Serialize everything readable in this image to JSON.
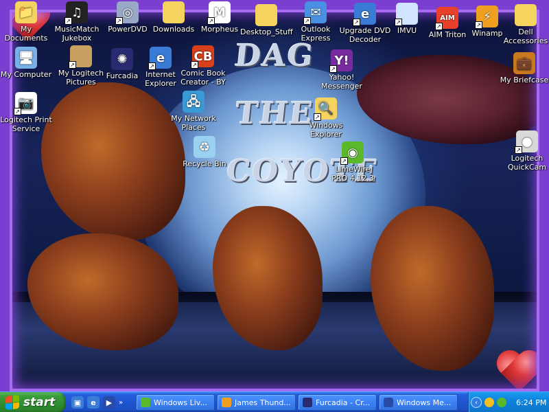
{
  "wallpaper": {
    "title_line1": "DAG",
    "title_line2": "THE",
    "title_line3": "COYOTE"
  },
  "desktop_icons": [
    {
      "id": "my-documents",
      "label": "My Documents",
      "icon": "folder-documents-icon",
      "color": "#f4d35e",
      "symbol": "📁"
    },
    {
      "id": "musicmatch",
      "label": "MusicMatch Jukebox",
      "icon": "musicmatch-icon",
      "color": "#222222",
      "symbol": "♫"
    },
    {
      "id": "powerdvd",
      "label": "PowerDVD",
      "icon": "dvd-disc-icon",
      "color": "#9aa8c8",
      "symbol": "◎"
    },
    {
      "id": "downloads",
      "label": "Downloads",
      "icon": "folder-icon",
      "color": "#f4d35e",
      "symbol": ""
    },
    {
      "id": "morpheus",
      "label": "Morpheus",
      "icon": "morpheus-icon",
      "color": "#ffffff",
      "symbol": "M"
    },
    {
      "id": "desktop-stuff",
      "label": "Desktop_Stuff",
      "icon": "folder-icon",
      "color": "#f4d35e",
      "symbol": ""
    },
    {
      "id": "outlook-express",
      "label": "Outlook Express",
      "icon": "outlook-express-icon",
      "color": "#4a90e2",
      "symbol": "✉"
    },
    {
      "id": "upgrade-dvd",
      "label": "Upgrade DVD Decoder",
      "icon": "internet-explorer-icon",
      "color": "#3a7bd5",
      "symbol": "e"
    },
    {
      "id": "imvu",
      "label": "IMVU",
      "icon": "imvu-icon",
      "color": "#d0e4ff",
      "symbol": ""
    },
    {
      "id": "aim-triton",
      "label": "AIM Triton",
      "icon": "aim-icon",
      "color": "#e8402a",
      "symbol": "AIM"
    },
    {
      "id": "winamp",
      "label": "Winamp",
      "icon": "winamp-icon",
      "color": "#f0a020",
      "symbol": "⚡"
    },
    {
      "id": "dell-accessories",
      "label": "Dell Accessories",
      "icon": "folder-icon",
      "color": "#f4d35e",
      "symbol": ""
    },
    {
      "id": "my-computer",
      "label": "My Computer",
      "icon": "computer-icon",
      "color": "#7ab0e8",
      "symbol": "🖥"
    },
    {
      "id": "logitech-pictures",
      "label": "My Logitech Pictures",
      "icon": "logitech-pictures-icon",
      "color": "#c8a060",
      "symbol": ""
    },
    {
      "id": "furcadia",
      "label": "Furcadia",
      "icon": "furcadia-icon",
      "color": "#2a2a70",
      "symbol": "✺"
    },
    {
      "id": "internet-explorer",
      "label": "Internet Explorer",
      "icon": "internet-explorer-icon",
      "color": "#3a7bd5",
      "symbol": "e"
    },
    {
      "id": "comic-book-creator",
      "label": "Comic Book Creator - BY",
      "icon": "comic-book-icon",
      "color": "#d8401a",
      "symbol": "CB"
    },
    {
      "id": "yahoo-messenger",
      "label": "Yahoo! Messenger",
      "icon": "yahoo-messenger-icon",
      "color": "#7a2aa0",
      "symbol": "Y!"
    },
    {
      "id": "my-briefcase",
      "label": "My Briefcase",
      "icon": "briefcase-icon",
      "color": "#c8781e",
      "symbol": "💼"
    },
    {
      "id": "logitech-print",
      "label": "Logitech Print Service",
      "icon": "logitech-print-icon",
      "color": "#ffffff",
      "symbol": "📷"
    },
    {
      "id": "my-network-places",
      "label": "My Network Places",
      "icon": "network-places-icon",
      "color": "#3a9ad5",
      "symbol": "🖧"
    },
    {
      "id": "windows-explorer",
      "label": "Windows Explorer",
      "icon": "windows-explorer-icon",
      "color": "#f4d35e",
      "symbol": "🔍"
    },
    {
      "id": "recycle-bin",
      "label": "Recycle Bin",
      "icon": "recycle-bin-icon",
      "color": "#9ad0f0",
      "symbol": "♻"
    },
    {
      "id": "limewire",
      "label": "LimeWire PRO 4.12.3",
      "icon": "limewire-icon",
      "color": "#5ab82a",
      "symbol": "◉"
    },
    {
      "id": "logitech-quickcam",
      "label": "Logitech QuickCam",
      "icon": "webcam-icon",
      "color": "#d8d8d8",
      "symbol": "●"
    }
  ],
  "taskbar": {
    "start_label": "start",
    "quick_launch": [
      {
        "name": "show-desktop-icon",
        "color": "#3a7bd5",
        "symbol": "▣"
      },
      {
        "name": "internet-explorer-icon",
        "color": "#3a7bd5",
        "symbol": "e"
      },
      {
        "name": "media-player-icon",
        "color": "#2a4aa8",
        "symbol": "▶"
      }
    ],
    "quick_launch_more": "»",
    "tasks": [
      {
        "name": "task-windows-live",
        "label": "Windows Liv...",
        "icon_color": "#5ab82a"
      },
      {
        "name": "task-james-thunder",
        "label": "James Thund...",
        "icon_color": "#f0a020"
      },
      {
        "name": "task-furcadia",
        "label": "Furcadia - Cr...",
        "icon_color": "#2a2a70"
      },
      {
        "name": "task-windows-media",
        "label": "Windows Me...",
        "icon_color": "#2a4aa8"
      }
    ],
    "tray": {
      "expand_arrow": "‹",
      "icons": [
        {
          "name": "yahoo-tray-icon",
          "color": "#f0c020"
        },
        {
          "name": "messenger-tray-icon",
          "color": "#5ab82a"
        }
      ],
      "clock": "6:24 PM"
    }
  }
}
